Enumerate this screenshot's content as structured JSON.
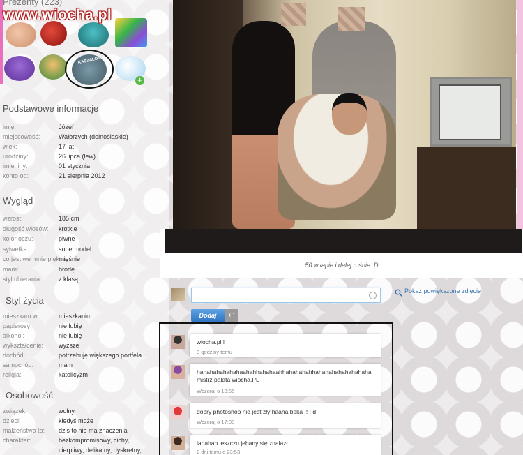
{
  "gifts": {
    "title": "Prezenty (223)",
    "kaszalot_label": "KASZALOT"
  },
  "watermark": {
    "text": "www.wiocha.pl"
  },
  "basic": {
    "title": "Podstawowe informacje",
    "rows": [
      {
        "label": "imię:",
        "value": "Józef"
      },
      {
        "label": "miejscowość:",
        "value": "Wałbrzych (dolnośląskie)"
      },
      {
        "label": "wiek:",
        "value": "17 lat"
      },
      {
        "label": "urodziny:",
        "value": "26 lipca (lew)"
      },
      {
        "label": "imieniny:",
        "value": "01 stycznia"
      },
      {
        "label": "konto od:",
        "value": "21 sierpnia 2012"
      }
    ]
  },
  "appearance": {
    "title": "Wygląd",
    "rows": [
      {
        "label": "wzrost:",
        "value": "185 cm"
      },
      {
        "label": "długość włosów:",
        "value": "krótkie"
      },
      {
        "label": "kolor oczu:",
        "value": "piwne"
      },
      {
        "label": "sylwetka:",
        "value": "supermodel"
      },
      {
        "label": "co jest we mnie piękne:",
        "value": "mięśnie"
      },
      {
        "label": "mam:",
        "value": "brodę"
      },
      {
        "label": "styl ubierania:",
        "value": "z klasą"
      }
    ]
  },
  "lifestyle": {
    "title": "Styl życia",
    "rows": [
      {
        "label": "mieszkam w:",
        "value": "mieszkaniu"
      },
      {
        "label": "papierosy:",
        "value": "nie lubię"
      },
      {
        "label": "alkohol:",
        "value": "nie lubię"
      },
      {
        "label": "wykształcenie:",
        "value": "wyższe"
      },
      {
        "label": "dochód:",
        "value": "potrzebuję większego portfela"
      },
      {
        "label": "samochód:",
        "value": "mam"
      },
      {
        "label": "religia:",
        "value": "katolicyzm"
      }
    ]
  },
  "personality": {
    "title": "Osobowość",
    "rows": [
      {
        "label": "związek:",
        "value": "wolny"
      },
      {
        "label": "dzieci:",
        "value": "kiedyś może"
      },
      {
        "label": "małżeństwo to:",
        "value": "dziś to nie ma znaczenia"
      },
      {
        "label": "charakter:",
        "value": "bezkompromisowy, cichy,"
      },
      {
        "label": "",
        "value": "cierpliwy, delikatny, dyskretny,"
      }
    ]
  },
  "photo": {
    "caption": "50 w łapie i dalej rośnie :D"
  },
  "comment_box": {
    "placeholder": "",
    "submit_label": "Dodaj",
    "zoom_label": "Pokaż powiększone zdjęcie"
  },
  "comments": [
    {
      "text": "wiocha.pl !",
      "meta": "3 godziny temu"
    },
    {
      "text": "hahahahahahahaahahhahahaahhahahahahhahahahahahahahahal mistrz palata wiocha.PL",
      "meta": "Wczoraj  o  18:56"
    },
    {
      "text": "dobry photoshop nie jest zły haaha beka !! ; d",
      "meta": "Wczoraj  o  17:08"
    },
    {
      "text": "lahahah leszczu jebany się znalazł",
      "meta": "2 dni temu  o  23:53"
    }
  ],
  "colors": {
    "accent": "#3b77b0",
    "button": "#2f75c2",
    "pink": "#e96fbf"
  }
}
